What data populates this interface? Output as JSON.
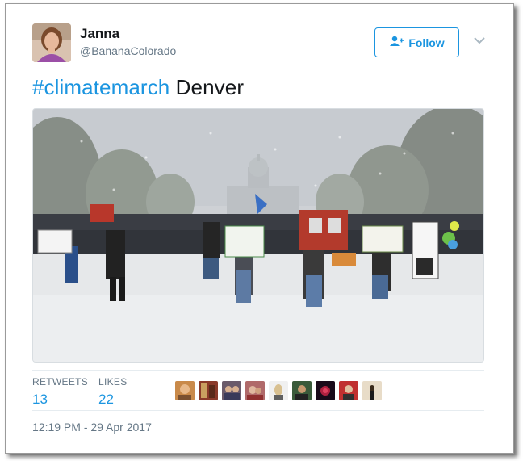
{
  "author": {
    "name": "Janna",
    "handle": "@BananaColorado"
  },
  "follow": {
    "label": "Follow",
    "icon": "add-person-icon"
  },
  "menu": {
    "icon": "chevron-down-icon"
  },
  "tweet": {
    "hashtag": "#climatemarch",
    "text": " Denver"
  },
  "photo": {
    "subject": "snowy-climate-march-crowd-photo"
  },
  "stats": {
    "retweets_label": "RETWEETS",
    "retweets_value": "13",
    "likes_label": "LIKES",
    "likes_value": "22"
  },
  "likers_count": 9,
  "timestamp": "12:19 PM - 29 Apr 2017",
  "colors": {
    "accent": "#1b95e0",
    "text": "#14171a",
    "muted": "#657786",
    "border": "#e6ecf0"
  }
}
